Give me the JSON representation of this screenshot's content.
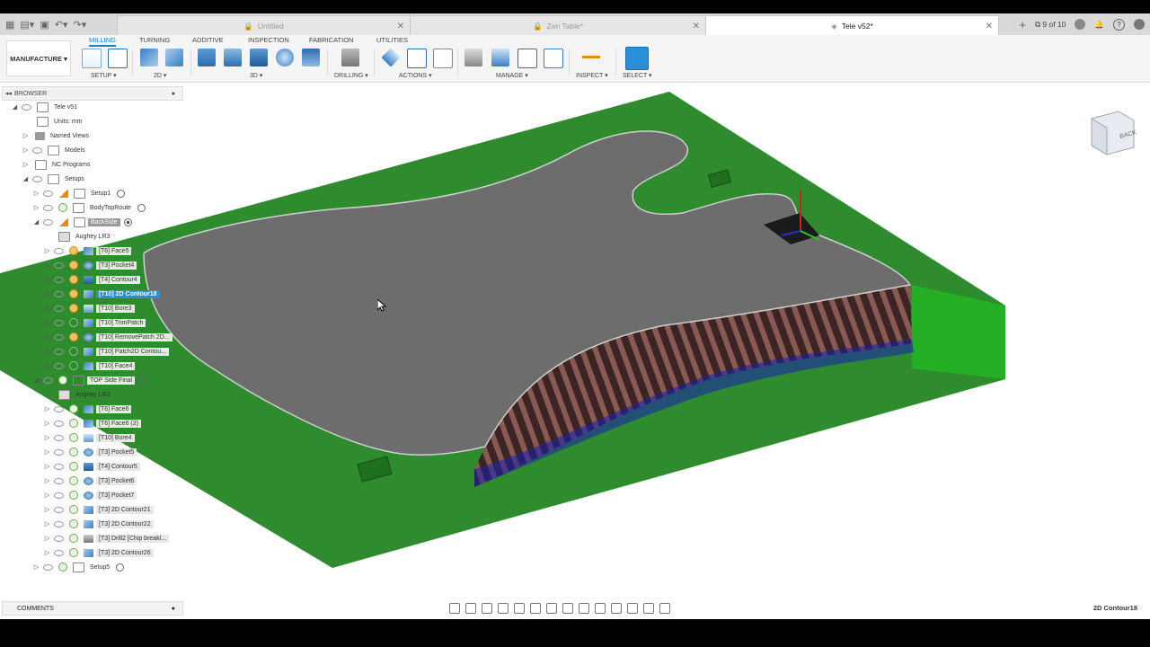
{
  "tabs": [
    {
      "label": "Untitled",
      "active": false
    },
    {
      "label": "Zen Table*",
      "active": false
    },
    {
      "label": "Tele v52*",
      "active": true
    }
  ],
  "version_indicator": "9 of 10",
  "workspace": "MANUFACTURE",
  "ribbon_tabs": [
    "MILLING",
    "TURNING",
    "ADDITIVE",
    "INSPECTION",
    "FABRICATION",
    "UTILITIES"
  ],
  "ribbon_groups": [
    "SETUP",
    "2D",
    "3D",
    "DRILLING",
    "ACTIONS",
    "MANAGE",
    "INSPECT",
    "SELECT"
  ],
  "browser": {
    "title": "BROWSER",
    "root": "Tele v51",
    "units": "Units: mm",
    "folders": [
      "Named Views",
      "Models",
      "NC Programs",
      "Setups"
    ],
    "setups": [
      {
        "name": "Setup1"
      },
      {
        "name": "BodyTopRoute"
      },
      {
        "name": "BackSide"
      },
      {
        "name": "TOP Side Final"
      },
      {
        "name": "Setup5"
      }
    ],
    "backside_stock": "Aughey LR3",
    "backside_ops": [
      "[T6] Face5",
      "[T3] Pocket4",
      "[T4] Contour4",
      "[T10] 2D Contour18",
      "[T10] Bore3",
      "[T10] TrimPatch",
      "[T10] RemovePatch 2D...",
      "[T10] Patch2D Contou...",
      "[T10] Face4"
    ],
    "top_stock": "Aughey LR3",
    "top_ops": [
      "[T6] Face6",
      "[T6] Face6 (2)",
      "[T10] Bore4",
      "[T3] Pocket5",
      "[T4] Contour5",
      "[T3] Pocket6",
      "[T3] Pocket7",
      "[T3] 2D Contour21",
      "[T3] 2D Contour22",
      "[T3] Drill2 [Chip breakl...",
      "[T3] 2D Contour26"
    ]
  },
  "comments_label": "COMMENTS",
  "status_selection": "2D Contour18",
  "viewcube_label": "BACK",
  "colors": {
    "accent": "#1a7fc0",
    "stock_green": "#2e8b2e",
    "body_gray": "#6d6d6d",
    "selected_row": "#2a8fd6"
  }
}
